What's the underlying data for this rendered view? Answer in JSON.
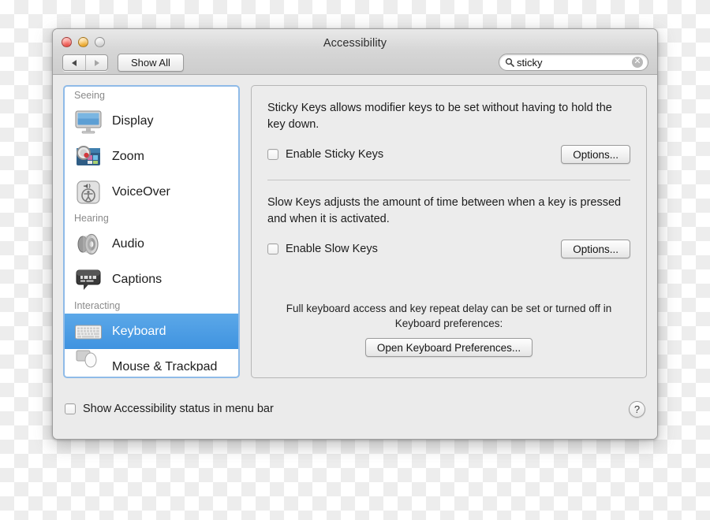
{
  "window": {
    "title": "Accessibility",
    "traffic_lights": [
      "close",
      "minimize",
      "zoom"
    ],
    "back_label": "back",
    "forward_label": "forward",
    "show_all_label": "Show All"
  },
  "search": {
    "value": "sticky",
    "icon": "search-icon",
    "clear_glyph": "✕"
  },
  "sidebar": {
    "groups": [
      {
        "header": "Seeing",
        "items": [
          {
            "label": "Display",
            "icon": "display-monitor-icon",
            "selected": false
          },
          {
            "label": "Zoom",
            "icon": "zoom-magnifier-icon",
            "selected": false
          },
          {
            "label": "VoiceOver",
            "icon": "voiceover-accessibility-icon",
            "selected": false
          }
        ]
      },
      {
        "header": "Hearing",
        "items": [
          {
            "label": "Audio",
            "icon": "audio-speaker-icon",
            "selected": false
          },
          {
            "label": "Captions",
            "icon": "captions-bubble-icon",
            "selected": false
          }
        ]
      },
      {
        "header": "Interacting",
        "items": [
          {
            "label": "Keyboard",
            "icon": "keyboard-icon",
            "selected": true
          },
          {
            "label": "Mouse & Trackpad",
            "icon": "mouse-trackpad-icon",
            "selected": false
          }
        ]
      }
    ]
  },
  "main": {
    "sticky_keys": {
      "description": "Sticky Keys allows modifier keys to be set without having to hold the key down.",
      "checkbox_label": "Enable Sticky Keys",
      "checked": false,
      "options_label": "Options..."
    },
    "slow_keys": {
      "description": "Slow Keys adjusts the amount of time between when a key is pressed and when it is activated.",
      "checkbox_label": "Enable Slow Keys",
      "checked": false,
      "options_label": "Options..."
    },
    "footer": {
      "note": "Full keyboard access and key repeat delay can be set or turned off in Keyboard preferences:",
      "button_label": "Open Keyboard Preferences..."
    }
  },
  "bottom_bar": {
    "checkbox_label": "Show Accessibility status in menu bar",
    "checked": false,
    "help_label": "?"
  },
  "colors": {
    "selection_blue": "#3f93e0",
    "focus_ring": "#8fbbe8",
    "window_chrome": "#d6d6d6",
    "pane_bg": "#ececec"
  }
}
